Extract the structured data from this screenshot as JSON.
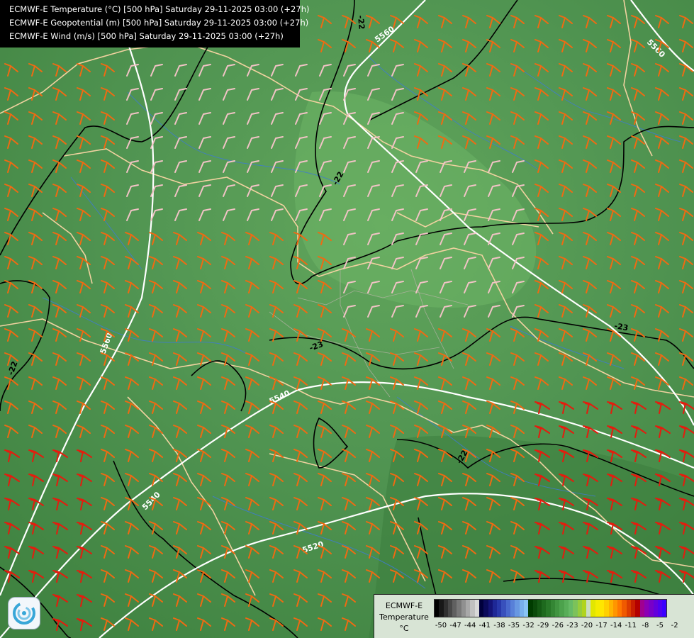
{
  "header": {
    "lines": [
      "ECMWF-E Temperature (°C) [500 hPa] Saturday 29-11-2025 03:00 (+27h)",
      "ECMWF-E Geopotential (m) [500 hPa] Saturday 29-11-2025 03:00 (+27h)",
      "ECMWF-E Wind (m/s) [500 hPa] Saturday 29-11-2025 03:00 (+27h)"
    ]
  },
  "contour_labels": {
    "geopotential": [
      "5560",
      "5560",
      "5540",
      "5540",
      "5520",
      "5560"
    ],
    "temperature": [
      "-22",
      "-22",
      "-23",
      "-23",
      "-22",
      "-22"
    ]
  },
  "legend": {
    "title_lines": [
      "ECMWF-E",
      "Temperature",
      "°C"
    ],
    "ticks": [
      "-50",
      "-47",
      "-44",
      "-41",
      "-38",
      "-35",
      "-32",
      "-29",
      "-26",
      "-23",
      "-20",
      "-17",
      "-14",
      "-11",
      "-8",
      "-5",
      "-2"
    ],
    "colors": [
      "#000000",
      "#181818",
      "#303030",
      "#484848",
      "#606060",
      "#787878",
      "#909090",
      "#a8a8a8",
      "#c0c0c0",
      "#d8d8d8",
      "#00003c",
      "#0a0a5a",
      "#141478",
      "#1e2896",
      "#2838aa",
      "#3850bc",
      "#4868cc",
      "#5880d8",
      "#6898e2",
      "#78b0ec",
      "#88c4f4",
      "#003c00",
      "#0a4a0a",
      "#145a14",
      "#1e6a1e",
      "#287828",
      "#348634",
      "#409440",
      "#4ca24c",
      "#58ae58",
      "#66ba66",
      "#7cc25a",
      "#96cc3c",
      "#b0d41e",
      "#caddc0",
      "#e2e600",
      "#f4ec00",
      "#ffe600",
      "#ffd000",
      "#ffb400",
      "#ff9600",
      "#ff7800",
      "#f05a00",
      "#dc3c00",
      "#c81e00",
      "#b40000",
      "#a00090",
      "#8c00b4",
      "#7800c8",
      "#6400dc",
      "#5000f0",
      "#3c00ff"
    ]
  },
  "wind_colors": {
    "light": "#f2c3c6",
    "medium": "#f06a12",
    "strong": "#e41c0e"
  },
  "map_colors": {
    "borders": "#f1d2a0",
    "rivers": "#3f7bd4",
    "contour_geo": "#ffffff",
    "contour_temp": "#000000"
  },
  "logo_name": "ecmwf-swirl-logo"
}
